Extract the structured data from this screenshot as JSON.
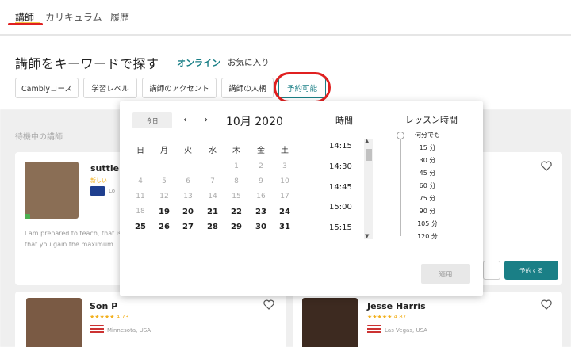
{
  "nav": {
    "tabs": [
      {
        "label": "講師"
      },
      {
        "label": "カリキュラム"
      },
      {
        "label": "履歴"
      }
    ]
  },
  "search": {
    "heading": "講師をキーワードで探す",
    "online_link": "オンライン",
    "favorites_link": "お気に入り",
    "filters": [
      {
        "label": "Camblyコース"
      },
      {
        "label": "学習レベル"
      },
      {
        "label": "講師のアクセント"
      },
      {
        "label": "講師の人柄"
      },
      {
        "label": "予約可能",
        "active": true
      }
    ]
  },
  "background": {
    "section_label": "待機中の講師",
    "card1": {
      "name": "suttie",
      "badge": "新しい",
      "location": "Lo",
      "bio": "I am prepared to teach, that is",
      "bio2": "that you gain the maximum",
      "reserve_button": "予約する"
    },
    "card2": {
      "name": "Son P",
      "rating": "4.73",
      "location": "Minnesota, USA"
    },
    "card3": {
      "name": "Jesse Harris",
      "rating": "4.87",
      "location": "Las Vegas, USA"
    }
  },
  "datepicker": {
    "today_button": "今日",
    "prev_icon": "chevron-left-icon",
    "next_icon": "chevron-right-icon",
    "month_label": "10月 2020",
    "weekdays": [
      "日",
      "月",
      "火",
      "水",
      "木",
      "金",
      "土"
    ],
    "weeks": [
      [
        {
          "d": ""
        },
        {
          "d": ""
        },
        {
          "d": ""
        },
        {
          "d": ""
        },
        {
          "d": "1",
          "s": "past"
        },
        {
          "d": "2",
          "s": "past"
        },
        {
          "d": "3",
          "s": "past"
        }
      ],
      [
        {
          "d": "4",
          "s": "past"
        },
        {
          "d": "5",
          "s": "past"
        },
        {
          "d": "6",
          "s": "past"
        },
        {
          "d": "7",
          "s": "past"
        },
        {
          "d": "8",
          "s": "past"
        },
        {
          "d": "9",
          "s": "past"
        },
        {
          "d": "10",
          "s": "past"
        }
      ],
      [
        {
          "d": "11",
          "s": "past"
        },
        {
          "d": "12",
          "s": "past"
        },
        {
          "d": "13",
          "s": "past"
        },
        {
          "d": "14",
          "s": "past"
        },
        {
          "d": "15",
          "s": "past"
        },
        {
          "d": "16",
          "s": "past"
        },
        {
          "d": "17",
          "s": "past"
        }
      ],
      [
        {
          "d": "18",
          "s": "past"
        },
        {
          "d": "19",
          "s": "avail"
        },
        {
          "d": "20",
          "s": "avail"
        },
        {
          "d": "21",
          "s": "avail"
        },
        {
          "d": "22",
          "s": "avail"
        },
        {
          "d": "23",
          "s": "avail"
        },
        {
          "d": "24",
          "s": "avail"
        }
      ],
      [
        {
          "d": "25",
          "s": "avail"
        },
        {
          "d": "26",
          "s": "avail"
        },
        {
          "d": "27",
          "s": "avail"
        },
        {
          "d": "28",
          "s": "avail"
        },
        {
          "d": "29",
          "s": "avail"
        },
        {
          "d": "30",
          "s": "avail"
        },
        {
          "d": "31",
          "s": "avail"
        }
      ]
    ],
    "time_title": "時間",
    "times": [
      "14:15",
      "14:30",
      "14:45",
      "15:00",
      "15:15"
    ],
    "length_title": "レッスン時間",
    "length_options": [
      "何分でも",
      "15 分",
      "30 分",
      "45 分",
      "60 分",
      "75 分",
      "90 分",
      "105 分",
      "120 分"
    ],
    "apply_button": "適用"
  },
  "colors": {
    "accent": "#1a7f86",
    "annotation_red": "#e02020",
    "nav_underline": "#f2c94c"
  }
}
